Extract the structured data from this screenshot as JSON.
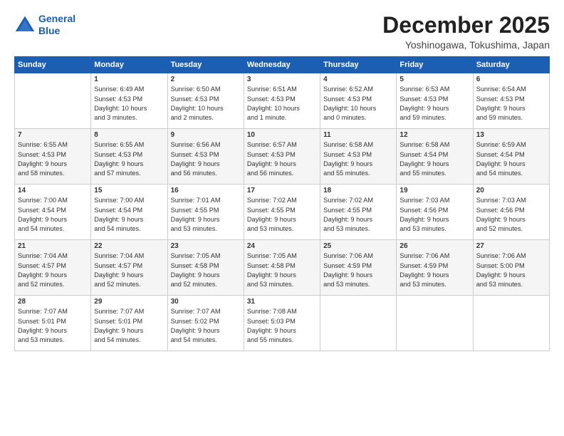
{
  "logo": {
    "line1": "General",
    "line2": "Blue"
  },
  "header": {
    "title": "December 2025",
    "subtitle": "Yoshinogawa, Tokushima, Japan"
  },
  "weekdays": [
    "Sunday",
    "Monday",
    "Tuesday",
    "Wednesday",
    "Thursday",
    "Friday",
    "Saturday"
  ],
  "weeks": [
    [
      {
        "day": "",
        "info": ""
      },
      {
        "day": "1",
        "info": "Sunrise: 6:49 AM\nSunset: 4:53 PM\nDaylight: 10 hours\nand 3 minutes."
      },
      {
        "day": "2",
        "info": "Sunrise: 6:50 AM\nSunset: 4:53 PM\nDaylight: 10 hours\nand 2 minutes."
      },
      {
        "day": "3",
        "info": "Sunrise: 6:51 AM\nSunset: 4:53 PM\nDaylight: 10 hours\nand 1 minute."
      },
      {
        "day": "4",
        "info": "Sunrise: 6:52 AM\nSunset: 4:53 PM\nDaylight: 10 hours\nand 0 minutes."
      },
      {
        "day": "5",
        "info": "Sunrise: 6:53 AM\nSunset: 4:53 PM\nDaylight: 9 hours\nand 59 minutes."
      },
      {
        "day": "6",
        "info": "Sunrise: 6:54 AM\nSunset: 4:53 PM\nDaylight: 9 hours\nand 59 minutes."
      }
    ],
    [
      {
        "day": "7",
        "info": "Sunrise: 6:55 AM\nSunset: 4:53 PM\nDaylight: 9 hours\nand 58 minutes."
      },
      {
        "day": "8",
        "info": "Sunrise: 6:55 AM\nSunset: 4:53 PM\nDaylight: 9 hours\nand 57 minutes."
      },
      {
        "day": "9",
        "info": "Sunrise: 6:56 AM\nSunset: 4:53 PM\nDaylight: 9 hours\nand 56 minutes."
      },
      {
        "day": "10",
        "info": "Sunrise: 6:57 AM\nSunset: 4:53 PM\nDaylight: 9 hours\nand 56 minutes."
      },
      {
        "day": "11",
        "info": "Sunrise: 6:58 AM\nSunset: 4:53 PM\nDaylight: 9 hours\nand 55 minutes."
      },
      {
        "day": "12",
        "info": "Sunrise: 6:58 AM\nSunset: 4:54 PM\nDaylight: 9 hours\nand 55 minutes."
      },
      {
        "day": "13",
        "info": "Sunrise: 6:59 AM\nSunset: 4:54 PM\nDaylight: 9 hours\nand 54 minutes."
      }
    ],
    [
      {
        "day": "14",
        "info": "Sunrise: 7:00 AM\nSunset: 4:54 PM\nDaylight: 9 hours\nand 54 minutes."
      },
      {
        "day": "15",
        "info": "Sunrise: 7:00 AM\nSunset: 4:54 PM\nDaylight: 9 hours\nand 54 minutes."
      },
      {
        "day": "16",
        "info": "Sunrise: 7:01 AM\nSunset: 4:55 PM\nDaylight: 9 hours\nand 53 minutes."
      },
      {
        "day": "17",
        "info": "Sunrise: 7:02 AM\nSunset: 4:55 PM\nDaylight: 9 hours\nand 53 minutes."
      },
      {
        "day": "18",
        "info": "Sunrise: 7:02 AM\nSunset: 4:55 PM\nDaylight: 9 hours\nand 53 minutes."
      },
      {
        "day": "19",
        "info": "Sunrise: 7:03 AM\nSunset: 4:56 PM\nDaylight: 9 hours\nand 53 minutes."
      },
      {
        "day": "20",
        "info": "Sunrise: 7:03 AM\nSunset: 4:56 PM\nDaylight: 9 hours\nand 52 minutes."
      }
    ],
    [
      {
        "day": "21",
        "info": "Sunrise: 7:04 AM\nSunset: 4:57 PM\nDaylight: 9 hours\nand 52 minutes."
      },
      {
        "day": "22",
        "info": "Sunrise: 7:04 AM\nSunset: 4:57 PM\nDaylight: 9 hours\nand 52 minutes."
      },
      {
        "day": "23",
        "info": "Sunrise: 7:05 AM\nSunset: 4:58 PM\nDaylight: 9 hours\nand 52 minutes."
      },
      {
        "day": "24",
        "info": "Sunrise: 7:05 AM\nSunset: 4:58 PM\nDaylight: 9 hours\nand 53 minutes."
      },
      {
        "day": "25",
        "info": "Sunrise: 7:06 AM\nSunset: 4:59 PM\nDaylight: 9 hours\nand 53 minutes."
      },
      {
        "day": "26",
        "info": "Sunrise: 7:06 AM\nSunset: 4:59 PM\nDaylight: 9 hours\nand 53 minutes."
      },
      {
        "day": "27",
        "info": "Sunrise: 7:06 AM\nSunset: 5:00 PM\nDaylight: 9 hours\nand 53 minutes."
      }
    ],
    [
      {
        "day": "28",
        "info": "Sunrise: 7:07 AM\nSunset: 5:01 PM\nDaylight: 9 hours\nand 53 minutes."
      },
      {
        "day": "29",
        "info": "Sunrise: 7:07 AM\nSunset: 5:01 PM\nDaylight: 9 hours\nand 54 minutes."
      },
      {
        "day": "30",
        "info": "Sunrise: 7:07 AM\nSunset: 5:02 PM\nDaylight: 9 hours\nand 54 minutes."
      },
      {
        "day": "31",
        "info": "Sunrise: 7:08 AM\nSunset: 5:03 PM\nDaylight: 9 hours\nand 55 minutes."
      },
      {
        "day": "",
        "info": ""
      },
      {
        "day": "",
        "info": ""
      },
      {
        "day": "",
        "info": ""
      }
    ]
  ]
}
